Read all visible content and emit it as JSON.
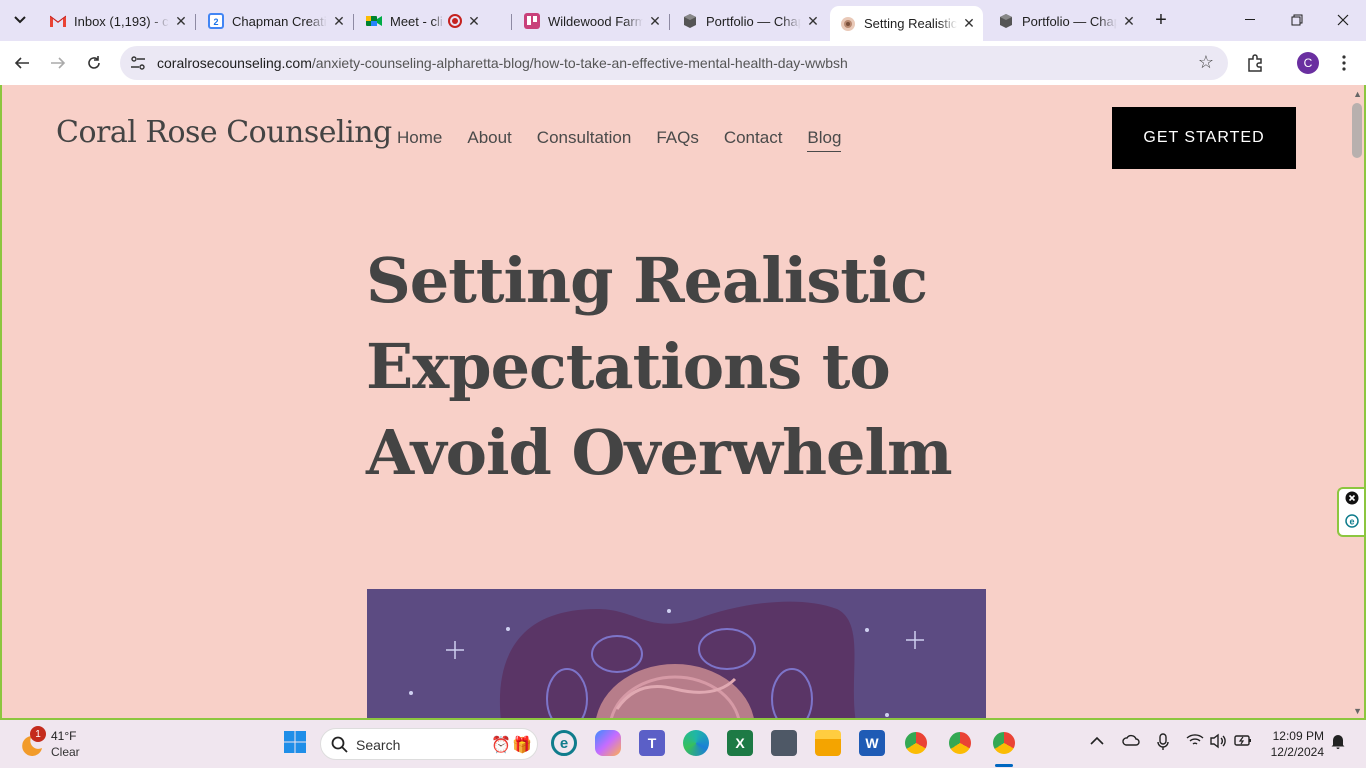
{
  "browser": {
    "tabs": [
      {
        "title": "Inbox (1,193) - c",
        "icon": "gmail-icon"
      },
      {
        "title": "Chapman Creati",
        "icon": "calendar-icon"
      },
      {
        "title": "Meet - client",
        "icon": "meet-icon"
      },
      {
        "title": "Wildewood Farm",
        "icon": "trello-icon"
      },
      {
        "title": "Portfolio — Chap",
        "icon": "cube-icon"
      },
      {
        "title": "Setting Realistic",
        "icon": "coral-rose-icon",
        "active": true
      },
      {
        "title": "Portfolio — Chap",
        "icon": "cube-icon"
      }
    ],
    "url_domain": "coralrosecounseling.com",
    "url_path": "/anxiety-counseling-alpharetta-blog/how-to-take-an-effective-mental-health-day-wwbsh",
    "profile_initial": "C"
  },
  "site": {
    "brand": "Coral Rose Counseling",
    "nav": [
      {
        "label": "Home"
      },
      {
        "label": "About"
      },
      {
        "label": "Consultation"
      },
      {
        "label": "FAQs"
      },
      {
        "label": "Contact"
      },
      {
        "label": "Blog",
        "current": true
      }
    ],
    "cta": "GET STARTED",
    "headline": "Setting Realistic Expectations to Avoid Overwhelm",
    "colors": {
      "background": "#f8d0c8",
      "text": "#444444",
      "cta_bg": "#000000",
      "hero_bg": "#5c4b82"
    }
  },
  "taskbar": {
    "weather_temp": "41°F",
    "weather_cond": "Clear",
    "weather_badge": "1",
    "search_placeholder": "Search",
    "time": "12:09 PM",
    "date": "12/2/2024"
  }
}
